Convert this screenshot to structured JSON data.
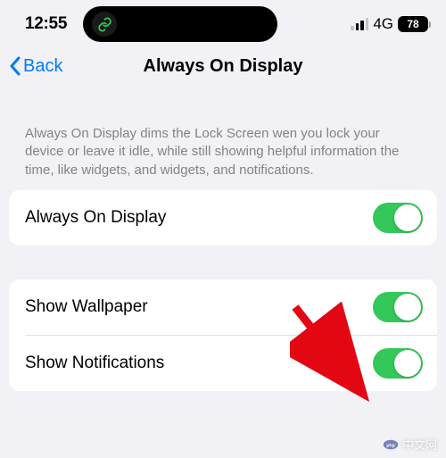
{
  "status": {
    "time": "12:55",
    "network": "4G",
    "battery": "78"
  },
  "nav": {
    "back_label": "Back",
    "title": "Always On Display"
  },
  "description": "Always On Display dims the Lock Screen wen you lock your device or leave it idle, while still showing helpful information the time, like widgets, and widgets, and notifications.",
  "group1": {
    "row0": {
      "label": "Always On Display",
      "enabled": true
    }
  },
  "group2": {
    "row0": {
      "label": "Show Wallpaper",
      "enabled": true
    },
    "row1": {
      "label": "Show Notifications",
      "enabled": true
    }
  },
  "watermark": "中文网"
}
